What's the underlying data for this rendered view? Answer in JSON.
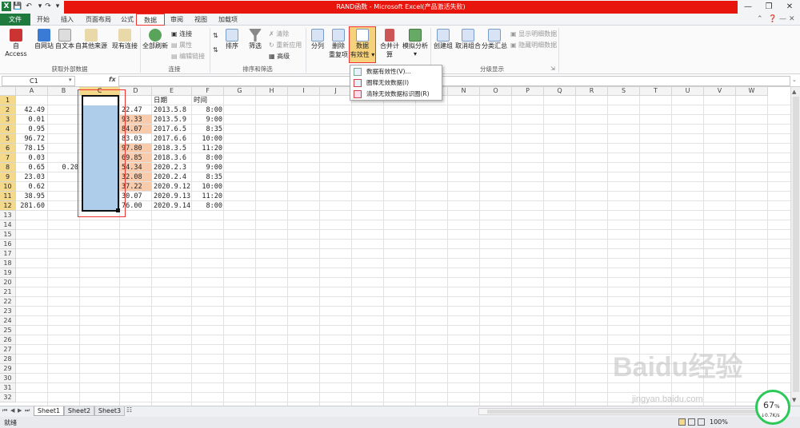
{
  "window": {
    "title": "RAND函数 - Microsoft Excel(产品激活失败)"
  },
  "tabs": {
    "file": "文件",
    "home": "开始",
    "insert": "插入",
    "layout": "页面布局",
    "formulas": "公式",
    "data": "数据",
    "review": "审阅",
    "view": "视图",
    "addins": "加载项"
  },
  "ribbon": {
    "from_access": "自 Access",
    "from_web": "自网站",
    "from_text": "自文本",
    "from_other": "自其他来源",
    "existing": "现有连接",
    "group_external": "获取外部数据",
    "refresh_all": "全部刷新",
    "connections": "连接",
    "properties": "属性",
    "edit_links": "编辑链接",
    "group_conn": "连接",
    "sort": "排序",
    "filter": "筛选",
    "clear": "清除",
    "reapply": "重新应用",
    "advanced": "高级",
    "group_sort": "排序和筛选",
    "text_to_cols": "分列",
    "remove_dup_1": "删除",
    "remove_dup_2": "重复项",
    "data_valid_1": "数据",
    "data_valid_2": "有效性",
    "consolidate": "合并计算",
    "whatif": "模拟分析",
    "group_outline": "分级显示",
    "group": "创建组",
    "ungroup": "取消组合",
    "subtotal": "分类汇总",
    "show_detail": "显示明细数据",
    "hide_detail": "隐藏明细数据"
  },
  "menu": {
    "item1": "数据有效性(V)...",
    "item2": "圈释无效数据(I)",
    "item3": "清除无效数据标识圈(R)"
  },
  "formula_bar": {
    "name_box": "C1",
    "fx": "fx",
    "value": ""
  },
  "columns": [
    "A",
    "B",
    "C",
    "D",
    "E",
    "F",
    "G",
    "H",
    "I",
    "J",
    "K",
    "L",
    "M",
    "N",
    "O",
    "P",
    "Q",
    "R",
    "S",
    "T",
    "U",
    "V",
    "W"
  ],
  "rows": [
    "1",
    "2",
    "3",
    "4",
    "5",
    "6",
    "7",
    "8",
    "9",
    "10",
    "11",
    "12",
    "13",
    "14",
    "15",
    "16",
    "17",
    "18",
    "19",
    "20",
    "21",
    "22",
    "23",
    "24",
    "25",
    "26",
    "27",
    "28",
    "29",
    "30",
    "31",
    "32"
  ],
  "headers": {
    "e1": "日期",
    "f1": "时间"
  },
  "colA": [
    "42.49",
    "0.01",
    "0.95",
    "96.72",
    "78.15",
    "0.03",
    "0.65",
    "23.03",
    "0.62",
    "38.95",
    "281.60"
  ],
  "b8": "0.20",
  "colD": [
    "22.47",
    "93.33",
    "84.07",
    "83.03",
    "97.80",
    "69.85",
    "54.34",
    "32.08",
    "37.22",
    "30.07",
    "76.00"
  ],
  "colE": [
    "2013.5.8",
    "2013.5.9",
    "2017.6.5",
    "2017.6.6",
    "2018.3.5",
    "2018.3.6",
    "2020.2.3",
    "2020.2.4",
    "2020.9.12",
    "2020.9.13",
    "2020.9.14"
  ],
  "colF": [
    "8:00",
    "9:00",
    "8:35",
    "10:00",
    "11:20",
    "8:00",
    "9:00",
    "8:35",
    "10:00",
    "11:20",
    "8:00"
  ],
  "sheets": [
    "Sheet1",
    "Sheet2",
    "Sheet3"
  ],
  "status": {
    "ready": "就绪",
    "zoom": "100%"
  },
  "net": {
    "percent": "67",
    "pct_sign": "%",
    "speed": "0.7K/s"
  },
  "watermark": {
    "brand": "Baidu经验",
    "url": "jingyan.baidu.com"
  },
  "colors": {
    "title_red": "#e8150d",
    "file_green": "#1f7a3e",
    "highlight_red": "#e33333",
    "selection_blue": "#aecdea",
    "peach": "#f8cbad"
  }
}
